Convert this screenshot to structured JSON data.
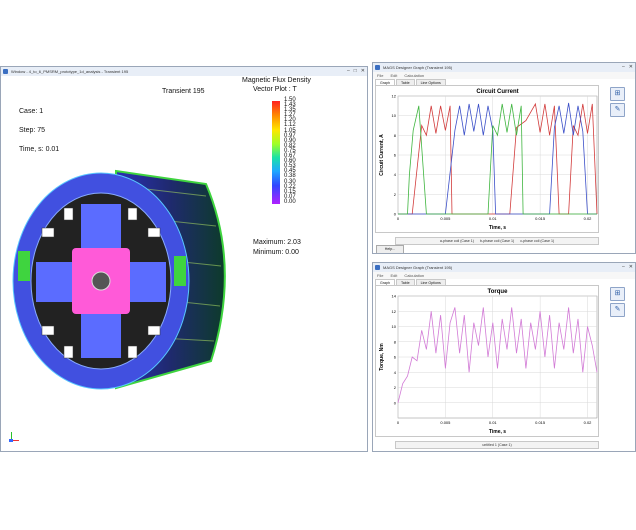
{
  "main_window": {
    "title": "Window - 4_to_6_PMSRM_prototype_1d_analysis - Transient 195",
    "overlay": {
      "sim_title": "Transient 195",
      "case": "Case: 1",
      "step": "Step: 75",
      "time": "Time, s: 0.01",
      "field_title": "Magnetic Flux Density",
      "field_subtitle": "Vector Plot : T",
      "colorbar_values": [
        "1.50",
        "1.43",
        "1.35",
        "1.27",
        "1.20",
        "1.12",
        "1.05",
        "0.97",
        "0.90",
        "0.82",
        "0.75",
        "0.67",
        "0.60",
        "0.53",
        "0.45",
        "0.38",
        "0.30",
        "0.22",
        "0.15",
        "0.07",
        "0.00"
      ],
      "maximum": "Maximum: 2.03",
      "minimum": "Minimum: 0.00"
    },
    "controls": {
      "minimize": "–",
      "maximize": "□",
      "close": "✕"
    }
  },
  "graph_window_1": {
    "title": "MAGS Designer Graph (Transient 195)",
    "menu": [
      "File",
      "Edit",
      "Calculation"
    ],
    "tabs": [
      "Graph",
      "Table",
      "Line Options"
    ],
    "help_label": "Help...",
    "legend": [
      "a-phase coil (Case 1)",
      "b-phase coil (Case 1)",
      "c-phase coil (Case 1)"
    ],
    "icons": [
      "grid-icon",
      "settings-icon"
    ],
    "colors": {
      "a": "#d23b3b",
      "b": "#3b4fc8",
      "c": "#3fb53f"
    }
  },
  "graph_window_2": {
    "title": "MAGS Designer Graph (Transient 195)",
    "menu": [
      "File",
      "Edit",
      "Calculation"
    ],
    "tabs": [
      "Graph",
      "Table",
      "Line Options"
    ],
    "legend": [
      "untitled 1 (Case 1)"
    ],
    "icons": [
      "grid-icon",
      "settings-icon"
    ],
    "colors": {
      "torque": "#d27bd6"
    }
  },
  "chart_data": [
    {
      "type": "line",
      "title": "Circuit Current",
      "xlabel": "Time, s",
      "ylabel": "Circuit Current, A",
      "xlim": [
        0,
        0.021
      ],
      "ylim": [
        0,
        12
      ],
      "x_ticks": [
        "0",
        "0.005",
        "0.01",
        "0.015",
        "0.02"
      ],
      "y_ticks": [
        "0",
        "2",
        "4",
        "6",
        "8",
        "10",
        "12"
      ],
      "grid": true,
      "series": [
        {
          "name": "a-phase coil (Case 1)",
          "x": [
            0,
            0.0015,
            0.0025,
            0.003,
            0.0035,
            0.004,
            0.0045,
            0.005,
            0.0055,
            0.0057,
            0.0075,
            0.008,
            0.0085,
            0.009,
            0.0095,
            0.01,
            0.0105,
            0.011,
            0.0115,
            0.0118,
            0.0125,
            0.0135,
            0.0145,
            0.015,
            0.0155,
            0.016,
            0.0165,
            0.017,
            0.0175,
            0.018,
            0.0185,
            0.019,
            0.0195,
            0.02,
            0.0205,
            0.021
          ],
          "y": [
            0,
            0,
            9.0,
            8.0,
            11.0,
            8.2,
            11.0,
            8.5,
            11.0,
            0,
            0,
            0,
            0,
            0,
            0,
            0,
            0,
            0,
            0,
            0,
            8.8,
            9.5,
            11.2,
            8.3,
            11.2,
            8.0,
            11.0,
            0,
            0,
            0,
            9.0,
            8.0,
            11.2,
            8.2,
            11.2,
            0
          ]
        },
        {
          "name": "b-phase coil (Case 1)",
          "x": [
            0,
            0.001,
            0.002,
            0.005,
            0.006,
            0.0065,
            0.007,
            0.0075,
            0.008,
            0.0085,
            0.009,
            0.0095,
            0.01,
            0.0103,
            0.0115,
            0.012,
            0.013,
            0.014,
            0.015,
            0.016,
            0.0165,
            0.017,
            0.0175,
            0.018,
            0.0185,
            0.019,
            0.0195,
            0.02,
            0.021
          ],
          "y": [
            0,
            0,
            0,
            0,
            8.5,
            11.0,
            8.0,
            11.2,
            8.4,
            11.2,
            8.0,
            11.0,
            8.5,
            0,
            0,
            0,
            0,
            0,
            0,
            0,
            8.8,
            11.0,
            8.2,
            11.3,
            8.0,
            11.0,
            8.4,
            0,
            0
          ]
        },
        {
          "name": "c-phase coil (Case 1)",
          "x": [
            0,
            0.001,
            0.0012,
            0.0016,
            0.0022,
            0.003,
            0.004,
            0.005,
            0.006,
            0.008,
            0.0095,
            0.01,
            0.0105,
            0.011,
            0.0115,
            0.012,
            0.0125,
            0.013,
            0.0132,
            0.014,
            0.015,
            0.016,
            0.017,
            0.018,
            0.019,
            0.02,
            0.021
          ],
          "y": [
            0,
            0,
            4.0,
            8.5,
            11.0,
            0,
            0,
            0,
            0,
            0,
            0,
            9.0,
            8.0,
            11.2,
            8.3,
            11.2,
            8.0,
            11.0,
            0,
            0,
            0,
            0,
            0,
            0,
            0,
            0,
            0
          ]
        }
      ]
    },
    {
      "type": "line",
      "title": "Torque",
      "xlabel": "Time, s",
      "ylabel": "Torque, Nm",
      "xlim": [
        0,
        0.021
      ],
      "ylim": [
        -2,
        14
      ],
      "x_ticks": [
        "0",
        "0.005",
        "0.01",
        "0.015",
        "0.02"
      ],
      "y_ticks": [
        "0",
        "2",
        "4",
        "6",
        "8",
        "10",
        "12",
        "14"
      ],
      "grid": true,
      "series": [
        {
          "name": "untitled 1 (Case 1)",
          "x": [
            0,
            0.0005,
            0.001,
            0.0015,
            0.002,
            0.0025,
            0.003,
            0.0035,
            0.004,
            0.0045,
            0.005,
            0.0055,
            0.006,
            0.0065,
            0.007,
            0.0075,
            0.008,
            0.0085,
            0.009,
            0.0095,
            0.01,
            0.0105,
            0.011,
            0.0115,
            0.012,
            0.0125,
            0.013,
            0.0135,
            0.014,
            0.0145,
            0.015,
            0.0155,
            0.016,
            0.0165,
            0.017,
            0.0175,
            0.018,
            0.0185,
            0.019,
            0.0195,
            0.02,
            0.0205,
            0.021
          ],
          "y": [
            0,
            2.5,
            3.5,
            6.0,
            5.5,
            9.5,
            7.0,
            12.0,
            6.5,
            11.5,
            4.5,
            10.5,
            12.5,
            6.5,
            11.5,
            4.0,
            10.5,
            7.5,
            12.5,
            6.0,
            10.5,
            4.5,
            11.0,
            7.0,
            12.5,
            6.5,
            11.0,
            4.5,
            10.5,
            7.0,
            12.0,
            6.0,
            11.5,
            4.5,
            10.5,
            7.0,
            12.5,
            6.5,
            11.0,
            4.0,
            10.0,
            7.5,
            4.0
          ]
        }
      ]
    }
  ]
}
